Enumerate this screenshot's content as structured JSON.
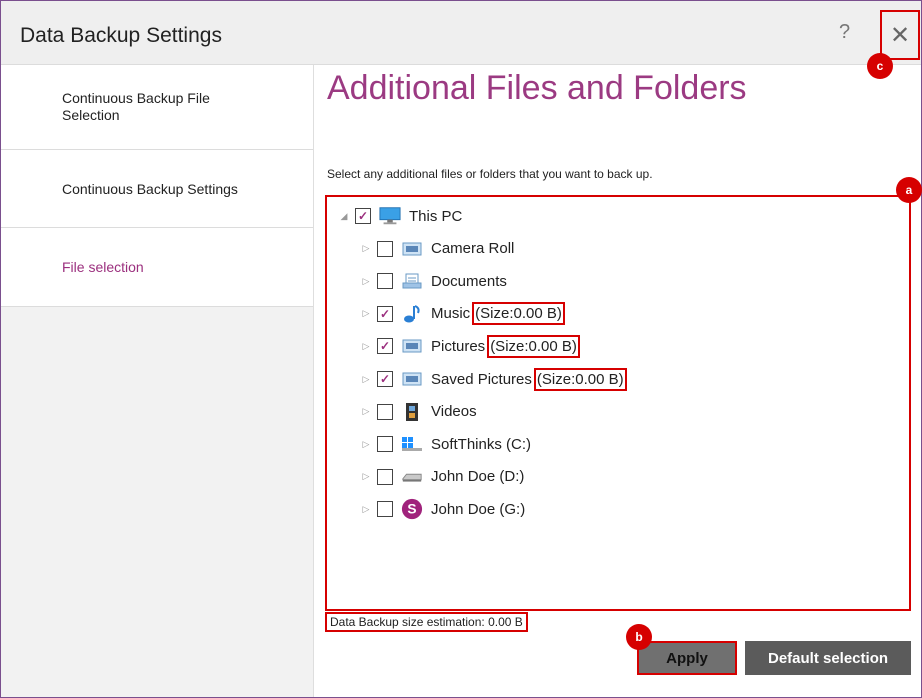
{
  "window": {
    "title": "Data Backup Settings",
    "help_label": "?",
    "close_label": "✕"
  },
  "sidebar": {
    "items": [
      {
        "label": "Continuous Backup File Selection"
      },
      {
        "label": "Continuous Backup Settings"
      },
      {
        "label": "File selection"
      }
    ]
  },
  "main": {
    "title": "Additional Files and Folders",
    "instruction": "Select any additional files or folders that you want to back up."
  },
  "tree": {
    "items": [
      {
        "label": "This PC",
        "checked": true,
        "expanded": true,
        "level": 0,
        "icon": "monitor-icon"
      },
      {
        "label": "Camera Roll",
        "checked": false,
        "level": 1,
        "icon": "folder-pictures-icon"
      },
      {
        "label": "Documents",
        "checked": false,
        "level": 1,
        "icon": "folder-documents-icon"
      },
      {
        "label": "Music",
        "size": "(Size:0.00 B)",
        "checked": true,
        "level": 1,
        "icon": "music-icon"
      },
      {
        "label": "Pictures",
        "size": "(Size:0.00 B)",
        "checked": true,
        "level": 1,
        "icon": "folder-pictures-icon"
      },
      {
        "label": "Saved Pictures",
        "size": "(Size:0.00 B)",
        "checked": true,
        "level": 1,
        "icon": "folder-pictures-icon"
      },
      {
        "label": "Videos",
        "checked": false,
        "level": 1,
        "icon": "film-icon"
      },
      {
        "label": "SoftThinks (C:)",
        "checked": false,
        "level": 1,
        "icon": "windows-drive-icon"
      },
      {
        "label": "John Doe (D:)",
        "checked": false,
        "level": 1,
        "icon": "drive-icon"
      },
      {
        "label": "John Doe (G:)",
        "checked": false,
        "level": 1,
        "icon": "s-logo-icon"
      }
    ]
  },
  "footer": {
    "estimation": "Data Backup size estimation: 0.00 B",
    "apply_label": "Apply",
    "default_label": "Default selection"
  },
  "badges": {
    "a": "a",
    "b": "b",
    "c": "c"
  },
  "colors": {
    "accent": "#9b2f7e",
    "highlight": "#d60000"
  }
}
